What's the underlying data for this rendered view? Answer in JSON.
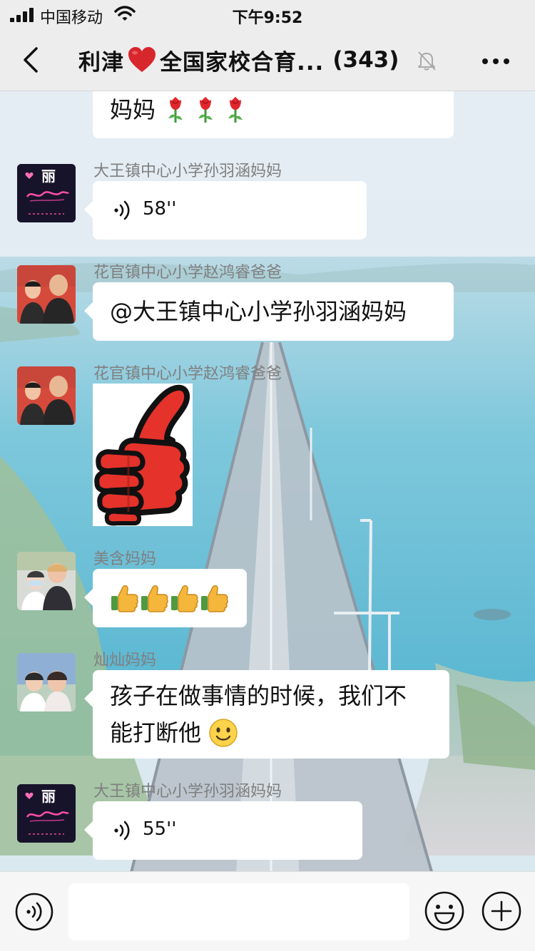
{
  "status_bar": {
    "carrier": "中国移动",
    "time": "下午9:52"
  },
  "nav": {
    "back_icon": "chevron-left-icon",
    "title_prefix": "利津",
    "heart_icon": "red-heart-emoji",
    "title_suffix": "全国家校合育...",
    "member_count": "(343)",
    "mute_icon": "bell-muted-icon",
    "more_icon": "more-dots-icon"
  },
  "messages": [
    {
      "type": "text",
      "text": "妈妈",
      "emoji": "rose-emoji"
    },
    {
      "type": "voice",
      "sender": "大王镇中心小学孙羽涵妈妈",
      "duration": "58''"
    },
    {
      "type": "text",
      "sender": "花官镇中心小学赵鸿睿爸爸",
      "text": "@大王镇中心小学孙羽涵妈妈"
    },
    {
      "type": "sticker",
      "sender": "花官镇中心小学赵鸿睿爸爸",
      "sticker": "thumbs-up-sticker"
    },
    {
      "type": "emoji",
      "sender": "美含妈妈",
      "emoji": "thumbs-up-emoji"
    },
    {
      "type": "text",
      "sender": "灿灿妈妈",
      "line1": "孩子在做事情的时候，我们不",
      "line2": "能打断他",
      "emoji": "smile-emoji"
    },
    {
      "type": "voice",
      "sender": "大王镇中心小学孙羽涵妈妈",
      "duration": "55''"
    }
  ],
  "avatars": {
    "li_logo_text": "丽"
  },
  "input_bar": {
    "voice_icon": "voice-toggle-icon",
    "input_value": "",
    "emoji_icon": "emoji-face-icon",
    "plus_icon": "plus-circle-icon"
  },
  "colors": {
    "bar_bg": "#ededed",
    "bubble_bg": "#ffffff",
    "sender_name": "#7f7f7f",
    "heart": "#d7262c",
    "sticker_red": "#e5322b"
  }
}
